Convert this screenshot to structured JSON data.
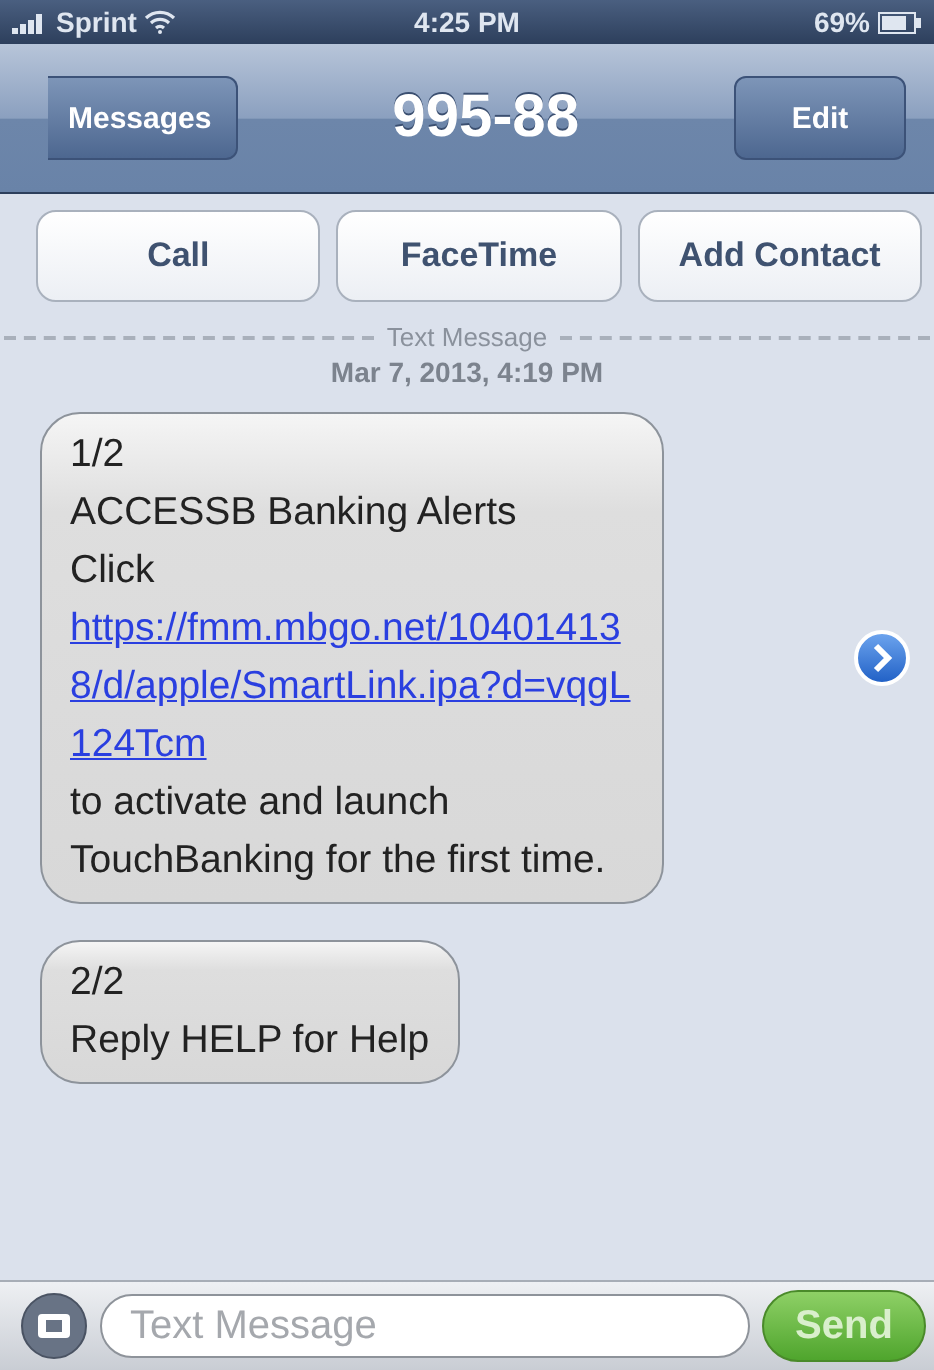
{
  "status_bar": {
    "carrier": "Sprint",
    "time": "4:25 PM",
    "battery": "69%"
  },
  "nav_bar": {
    "back": "Messages",
    "title": "995-88",
    "edit": "Edit"
  },
  "actions": [
    "Call",
    "FaceTime",
    "Add Contact"
  ],
  "thread": {
    "label": "Text Message",
    "date": "Mar 7, 2013, 4:19 PM"
  },
  "messages": [
    {
      "counter": "1/2",
      "text_before": "ACCESSB Banking Alerts\nClick",
      "link": "https://fmm.mbgo.net/104014138/d/apple/SmartLink.ipa?d=vqgL124Tcm",
      "text_after": "to activate and launch TouchBanking for the first time.",
      "has_link_arrow": true
    },
    {
      "counter": "2/2",
      "text_before": "Reply HELP for Help",
      "has_link_arrow": false
    }
  ],
  "composer": {
    "placeholder": "Text Message",
    "send": "Send"
  }
}
